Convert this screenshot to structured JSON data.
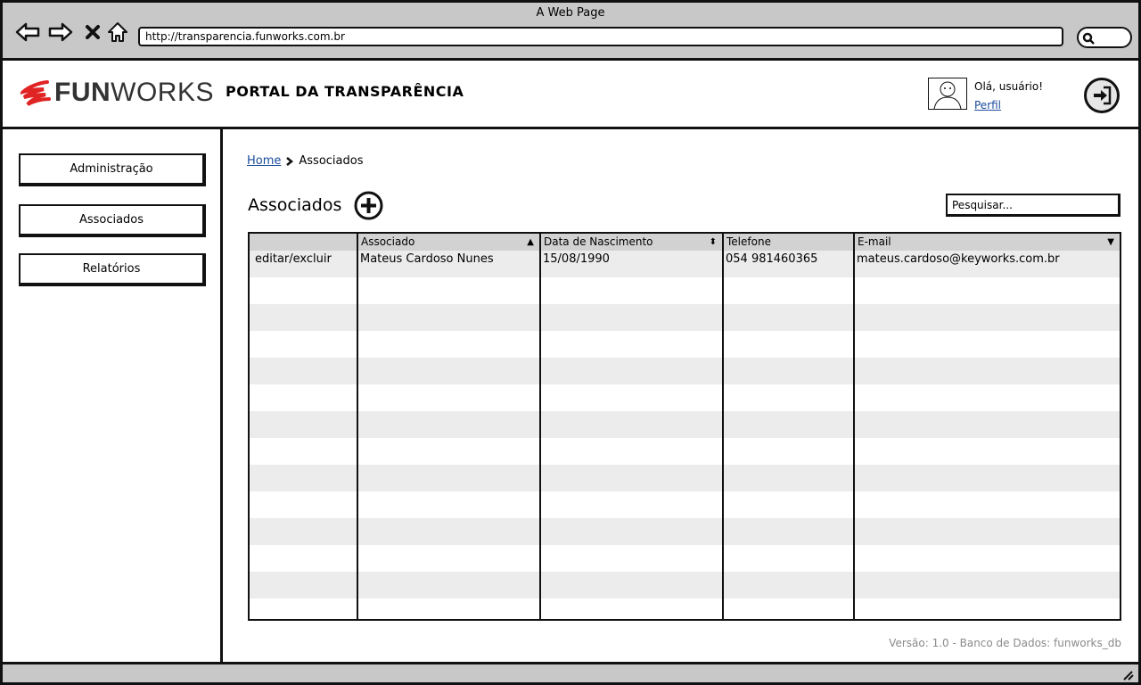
{
  "browser": {
    "window_title": "A Web Page",
    "url": "http://transparencia.funworks.com.br",
    "icons": [
      "back-arrow-icon",
      "forward-arrow-icon",
      "close-x-icon",
      "home-icon",
      "search-icon"
    ]
  },
  "header": {
    "logo_primary": "FUN",
    "logo_secondary": "WORKS",
    "portal_title": "PORTAL DA TRANSPARÊNCIA",
    "greeting": "Olá, usuário!",
    "profile_link": "Perfil"
  },
  "sidebar": {
    "items": [
      {
        "label": "Administração"
      },
      {
        "label": "Associados"
      },
      {
        "label": "Relatórios"
      }
    ]
  },
  "main": {
    "breadcrumb": {
      "home": "Home",
      "current": "Associados"
    },
    "title": "Associados",
    "search_placeholder": "Pesquisar...",
    "table": {
      "columns": [
        {
          "label": ""
        },
        {
          "label": "Associado",
          "sort": "▲"
        },
        {
          "label": "Data de Nascimento",
          "sort": "⬍"
        },
        {
          "label": "Telefone",
          "sort": ""
        },
        {
          "label": "E-mail",
          "sort": "▼"
        }
      ],
      "rows": [
        [
          "editar/excluir",
          "Mateus Cardoso Nunes",
          "15/08/1990",
          "054 981460365",
          "mateus.cardoso@keyworks.com.br"
        ]
      ]
    },
    "footer": "Versão: 1.0 - Banco de Dados: funworks_db"
  },
  "colors": {
    "chrome": "#c8c8c8",
    "link": "#1a4b9b",
    "logo_accent": "#e02424",
    "grid_header": "#d2d2d2",
    "row_alt": "#ececec"
  }
}
